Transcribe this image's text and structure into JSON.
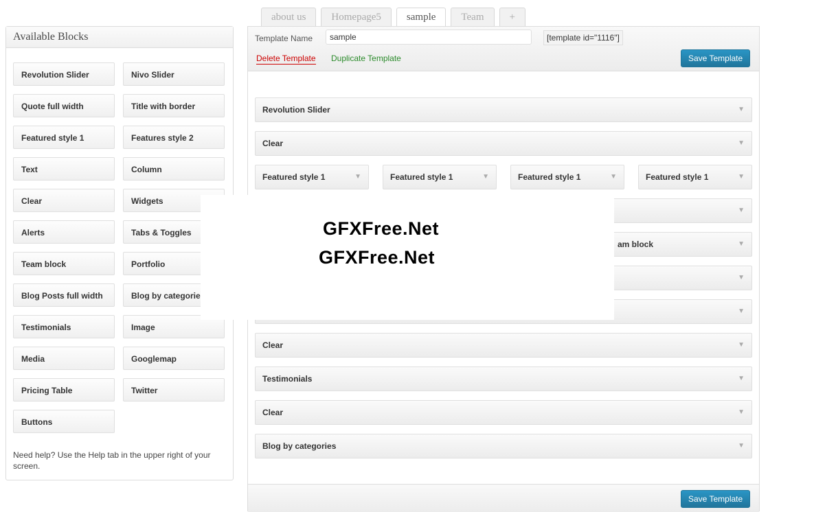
{
  "tabs": [
    {
      "label": "about us",
      "active": false
    },
    {
      "label": "Homepage5",
      "active": false
    },
    {
      "label": "sample",
      "active": true
    },
    {
      "label": "Team",
      "active": false
    },
    {
      "label": "+",
      "active": false
    }
  ],
  "sidebar": {
    "title": "Available Blocks",
    "blocks": [
      "Revolution Slider",
      "Nivo Slider",
      "Quote full width",
      "Title with border",
      "Featured style 1",
      "Features style 2",
      "Text",
      "Column",
      "Clear",
      "Widgets",
      "Alerts",
      "Tabs & Toggles",
      "Team block",
      "Portfolio",
      "Blog Posts full width",
      "Blog by categories",
      "Testimonials",
      "Image",
      "Media",
      "Googlemap",
      "Pricing Table",
      "Twitter",
      "Buttons"
    ],
    "help": "Need help? Use the Help tab in the upper right of your screen."
  },
  "template": {
    "name_label": "Template Name",
    "name_value": "sample",
    "shortcode": "[template id=\"1116\"]",
    "delete_label": "Delete Template",
    "duplicate_label": "Duplicate Template",
    "save_label": "Save Template",
    "save_label_bottom": "Save Template"
  },
  "rows": {
    "r1": "Revolution Slider",
    "r2": "Clear",
    "featured": [
      "Featured style 1",
      "Featured style 1",
      "Featured style 1",
      "Featured style 1"
    ],
    "r4": "",
    "r5": "am block",
    "r6": "",
    "r7": "",
    "r8": "Clear",
    "r9": "Testimonials",
    "r10": "Clear",
    "r11": "Blog by categories"
  },
  "arrow_glyph": "▼",
  "watermark": [
    "GFXFree.Net",
    "GFXFree.Net"
  ]
}
